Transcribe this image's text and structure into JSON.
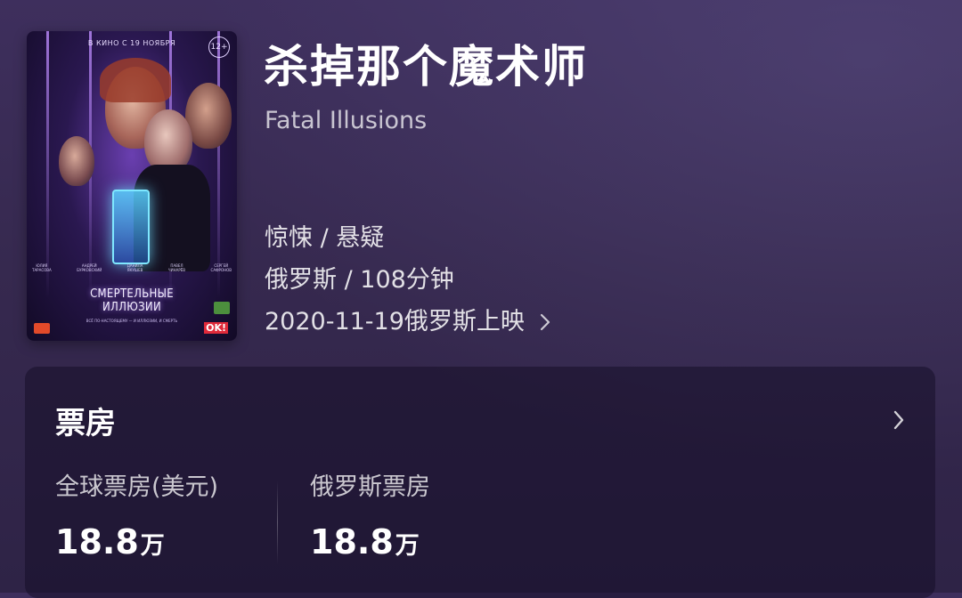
{
  "movie": {
    "title": "杀掉那个魔术师",
    "original_title": "Fatal Illusions",
    "genre": "惊悚 / 悬疑",
    "region_duration": "俄罗斯 / 108分钟",
    "release": "2020-11-19俄罗斯上映"
  },
  "poster": {
    "release_text": "В КИНО С 19 НОЯБРЯ",
    "age_rating": "12+",
    "title_line1": "СМЕРТЕЛЬНЫЕ",
    "title_line2": "ИЛЛЮЗИИ",
    "tagline": "ВСЁ ПО-НАСТОЯЩЕМУ — И ИЛЛЮЗИИ, И СМЕРТЬ",
    "cast": [
      {
        "first": "ЮЛИЯ",
        "last": "ТАРАСОВА"
      },
      {
        "first": "АНДРЕЙ",
        "last": "БУРКОВСКИЙ"
      },
      {
        "first": "ДАНИЛА",
        "last": "ЯКУШЕВ"
      },
      {
        "first": "ПАВЕЛ",
        "last": "ЧИНАРЁВ"
      },
      {
        "first": "СЕРГЕЙ",
        "last": "САФРОНОВ"
      }
    ],
    "logo_ok": "OK!"
  },
  "box_office": {
    "heading": "票房",
    "global": {
      "label": "全球票房(美元)",
      "value": "18.8",
      "unit": "万"
    },
    "russia": {
      "label": "俄罗斯票房",
      "value": "18.8",
      "unit": "万"
    }
  },
  "colors": {
    "background": "#3a2c57",
    "card": "#1f1634",
    "text_primary": "#ffffff"
  },
  "icons": {
    "release_arrow": "chevron-right-icon",
    "box_office_arrow": "chevron-right-icon"
  }
}
